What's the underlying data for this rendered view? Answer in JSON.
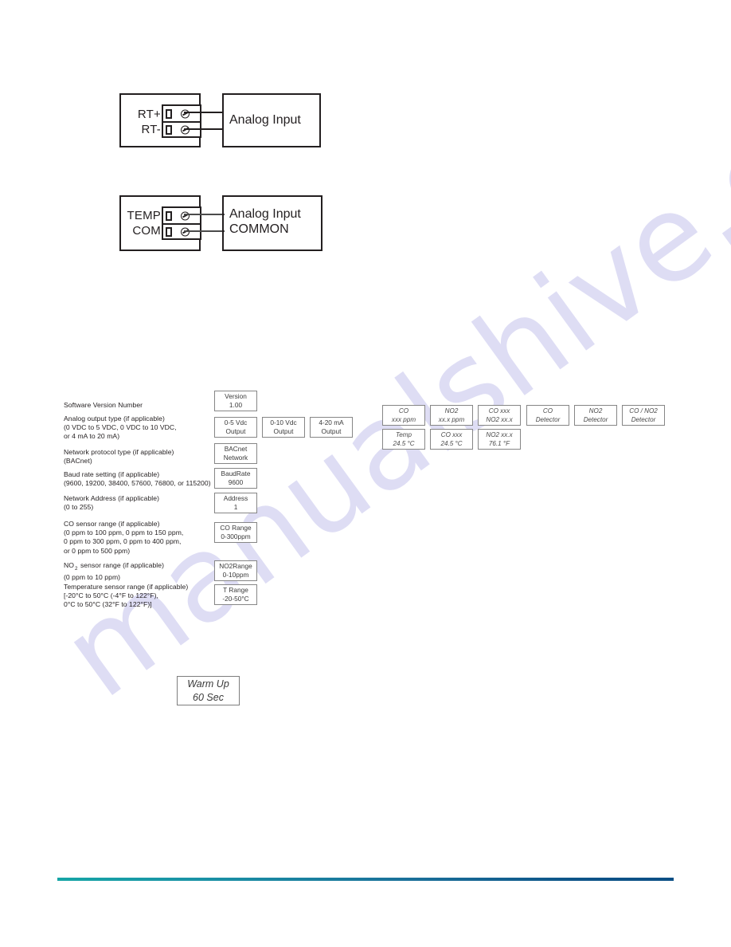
{
  "page": {
    "background_color": "#ffffff",
    "ink_color": "#231f20",
    "watermark_text": "manualshive.com",
    "watermark_color": "#c9c8ee"
  },
  "footer": {
    "rule_gradient_from": "#16a5a6",
    "rule_gradient_to": "#0b4f85"
  },
  "diagrams": [
    {
      "name": "rt-analog-input",
      "terminals": [
        {
          "label": "RT+"
        },
        {
          "label": "RT-"
        }
      ],
      "device_lines": [
        "Analog Input"
      ]
    },
    {
      "name": "temp-common-analog-input",
      "terminals": [
        {
          "label": "TEMP"
        },
        {
          "label": "COM"
        }
      ],
      "device_lines": [
        "Analog Input",
        "COMMON"
      ]
    }
  ],
  "sequence": {
    "items": [
      {
        "description_lines": [
          "Software Version Number"
        ],
        "boxes": [
          {
            "line1": "Version",
            "line2": "1.00"
          }
        ]
      },
      {
        "description_lines": [
          "Analog output type (if applicable)",
          "(0 VDC  to 5 VDC, 0 VDC to 10 VDC,",
          "or 4 mA to 20 mA)"
        ],
        "boxes": [
          {
            "line1": "0-5 Vdc",
            "line2": "Output"
          },
          {
            "line1": "0-10 Vdc",
            "line2": "Output"
          },
          {
            "line1": "4-20 mA",
            "line2": "Output"
          }
        ]
      },
      {
        "description_lines": [
          "Network protocol type (if applicable)",
          "(BACnet)"
        ],
        "boxes": [
          {
            "line1": "BACnet",
            "line2": "Network"
          }
        ]
      },
      {
        "description_lines": [
          "Baud rate setting (if applicable)",
          "(9600, 19200, 38400, 57600, 76800, or 115200)"
        ],
        "boxes": [
          {
            "line1": "BaudRate",
            "line2": "9600"
          }
        ]
      },
      {
        "description_lines": [
          "Network Address (if applicable)",
          "(0 to 255)"
        ],
        "boxes": [
          {
            "line1": "Address",
            "line2": "1"
          }
        ]
      },
      {
        "description_lines": [
          "CO sensor range (if applicable)",
          "(0 ppm to 100 ppm, 0 ppm to 150 ppm,",
          "0 ppm to 300 ppm, 0 ppm to 400 ppm,",
          "or 0 ppm to 500 ppm)"
        ],
        "boxes": [
          {
            "line1": "CO Range",
            "line2": "0-300ppm"
          }
        ]
      },
      {
        "description_lines": [
          "NO|2| sensor range (if applicable)",
          "(0 ppm to 10 ppm)"
        ],
        "boxes": [
          {
            "line1": "NO2Range",
            "line2": "0-10ppm"
          }
        ]
      },
      {
        "description_lines": [
          "Temperature sensor range (if applicable)",
          "[-20°C to 50°C (-4°F to 122°F),",
          "0°C to 50°C (32°F to 122°F)]"
        ],
        "boxes": [
          {
            "line1": "T Range",
            "line2": "-20-50°C"
          }
        ]
      }
    ]
  },
  "display_modes": {
    "row1": [
      {
        "line1": "CO",
        "line2": "xxx ppm"
      },
      {
        "line1": "NO2",
        "line2": "xx.x ppm"
      },
      {
        "line1": "CO xxx",
        "line2": "NO2 xx.x"
      },
      {
        "line1": "CO",
        "line2": "Detector"
      },
      {
        "line1": "NO2",
        "line2": "Detector"
      },
      {
        "line1": "CO / NO2",
        "line2": "Detector"
      }
    ],
    "row2": [
      {
        "line1": "Temp",
        "line2": "24.5 °C"
      },
      {
        "line1": "CO xxx",
        "line2": "24.5 °C"
      },
      {
        "line1": "NO2 xx.x",
        "line2": "76.1 °F"
      }
    ]
  },
  "warm_up": {
    "line1": "Warm Up",
    "line2": "60 Sec"
  }
}
